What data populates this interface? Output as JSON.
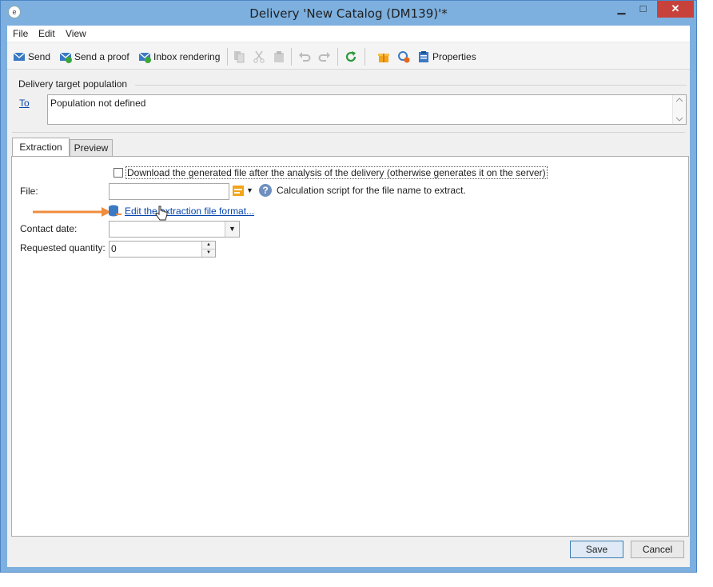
{
  "window": {
    "title": "Delivery 'New Catalog (DM139)'*",
    "controls": {
      "minimize": "▁",
      "maximize": "□",
      "close": "✕"
    }
  },
  "menu": [
    "File",
    "Edit",
    "View"
  ],
  "toolbar": {
    "send": "Send",
    "send_proof": "Send a proof",
    "inbox_rendering": "Inbox rendering",
    "properties": "Properties"
  },
  "target": {
    "section_label": "Delivery target population",
    "to_link": "To",
    "to_value": "Population not defined"
  },
  "tabs": [
    "Extraction",
    "Preview"
  ],
  "extraction": {
    "download_checkbox_label": "Download the generated file after the analysis of the delivery (otherwise generates it on the server)",
    "download_checked": false,
    "file_label": "File:",
    "file_value": "",
    "file_help_text": "Calculation script for the file name to extract.",
    "edit_format_link": "Edit the extraction file format...",
    "contact_date_label": "Contact date:",
    "contact_date_value": "",
    "requested_quantity_label": "Requested quantity:",
    "requested_quantity_value": "0"
  },
  "footer": {
    "save": "Save",
    "cancel": "Cancel"
  },
  "colors": {
    "titlebar": "#7db0df",
    "close_button": "#c7423a",
    "link": "#0645ad",
    "arrow": "#f08c3c"
  }
}
